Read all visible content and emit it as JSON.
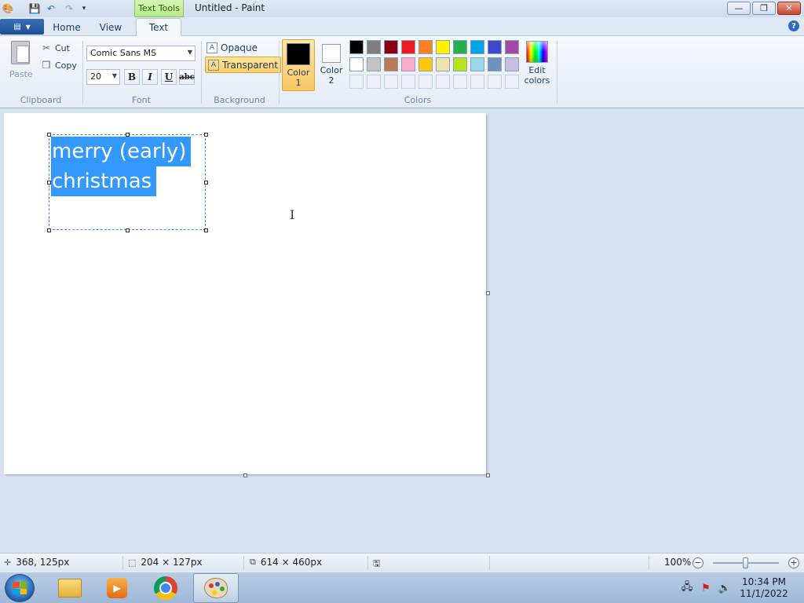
{
  "window": {
    "title": "Untitled - Paint",
    "context_tab": "Text Tools",
    "minimize_glyph": "—",
    "maximize_glyph": "❐",
    "close_glyph": "✕"
  },
  "tabs": [
    {
      "label": "Home"
    },
    {
      "label": "View"
    },
    {
      "label": "Text",
      "active": true
    }
  ],
  "ribbon": {
    "clipboard": {
      "group_label": "Clipboard",
      "paste_label": "Paste",
      "cut_label": "Cut",
      "copy_label": "Copy"
    },
    "font": {
      "group_label": "Font",
      "family": "Comic Sans MS",
      "size": "20",
      "bold_label": "B",
      "italic_label": "I",
      "underline_label": "U",
      "strike_label": "abc"
    },
    "background": {
      "group_label": "Background",
      "opaque_label": "Opaque",
      "transparent_label": "Transparent",
      "selected": "Transparent"
    },
    "colors": {
      "group_label": "Colors",
      "color1_label_line1": "Color",
      "color1_label_line2": "1",
      "color2_label_line1": "Color",
      "color2_label_line2": "2",
      "color1": "#000000",
      "color2": "#ffffff",
      "edit_label_line1": "Edit",
      "edit_label_line2": "colors",
      "palette_row1": [
        "#000000",
        "#7f7f7f",
        "#880015",
        "#ed1c24",
        "#ff7f27",
        "#fff200",
        "#22b14c",
        "#00a2e8",
        "#3f48cc",
        "#a349a4"
      ],
      "palette_row2": [
        "#ffffff",
        "#c3c3c3",
        "#b97a57",
        "#ffaec9",
        "#ffc90e",
        "#efe4b0",
        "#b5e61d",
        "#99d9ea",
        "#7092be",
        "#c8bfe7"
      ]
    }
  },
  "canvas": {
    "text_line1": "merry (early)",
    "text_line2": "christmas",
    "selection_color": "#3399ff"
  },
  "status": {
    "cursor_pos": "368, 125px",
    "selection_size": "204 × 127px",
    "image_size": "614 × 460px",
    "zoom": "100%"
  },
  "taskbar": {
    "time": "10:34 PM",
    "date": "11/1/2022"
  }
}
